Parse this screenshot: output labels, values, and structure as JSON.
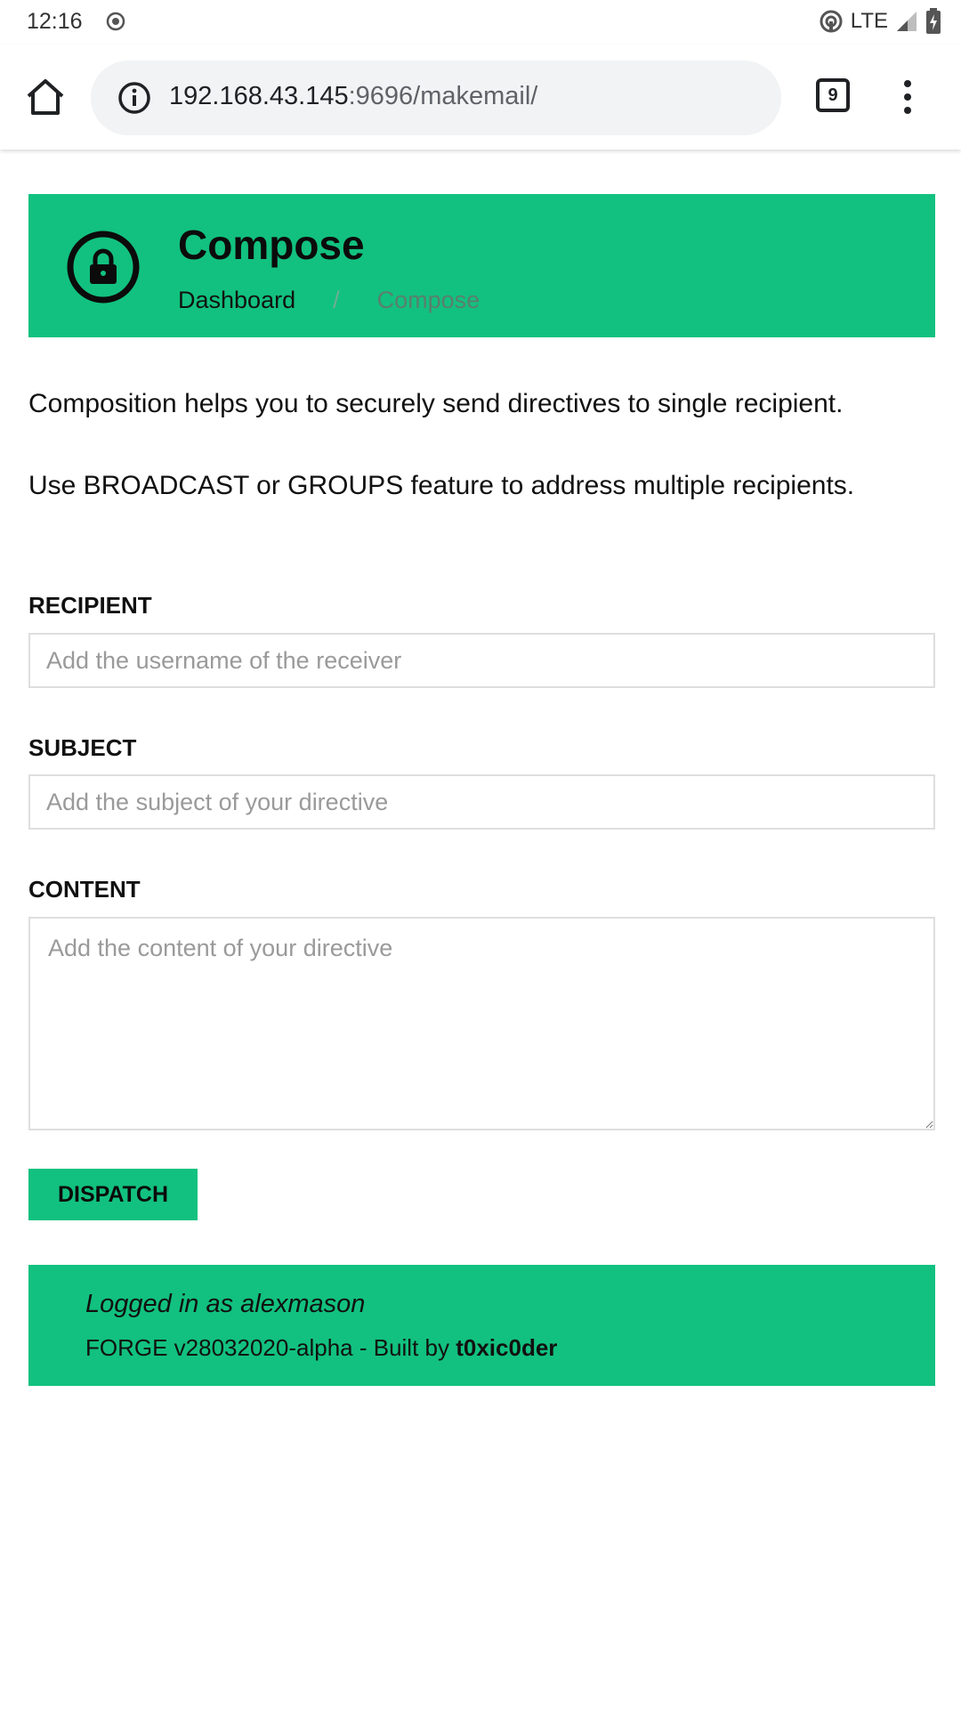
{
  "status_bar": {
    "time": "12:16",
    "network": "LTE"
  },
  "browser": {
    "url_host": "192.168.43.145",
    "url_rest": ":9696/makemail/",
    "tab_count": "9"
  },
  "header": {
    "title": "Compose",
    "breadcrumb": {
      "home": "Dashboard",
      "separator": "/",
      "current": "Compose"
    }
  },
  "intro": {
    "line1": "Composition helps you to securely send directives to single recipient.",
    "line2": "Use BROADCAST or GROUPS feature to address multiple recipients."
  },
  "form": {
    "recipient_label": "RECIPIENT",
    "recipient_placeholder": "Add the username of the receiver",
    "recipient_value": "",
    "subject_label": "SUBJECT",
    "subject_placeholder": "Add the subject of your directive",
    "subject_value": "",
    "content_label": "CONTENT",
    "content_placeholder": "Add the content of your directive",
    "content_value": "",
    "submit_label": "DISPATCH"
  },
  "footer": {
    "logged_in": "Logged in as alexmason",
    "build_text": "FORGE v28032020-alpha - Built by ",
    "author": "t0xic0der"
  },
  "colors": {
    "accent": "#12c17f",
    "field_border": "#dedede",
    "placeholder": "#9a9a9a"
  }
}
